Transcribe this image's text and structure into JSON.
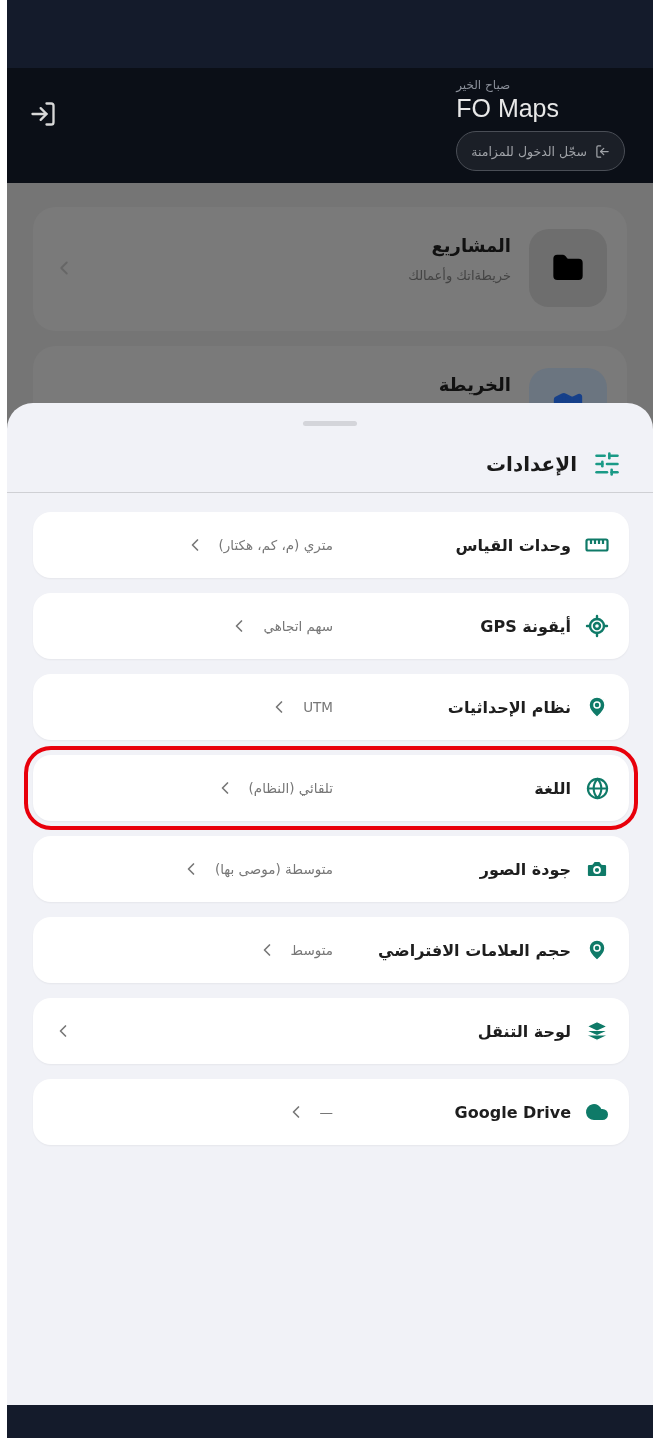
{
  "header": {
    "greeting": "صباح الخير",
    "title": "FO Maps",
    "sync_button": "سجّل الدخول للمزامنة"
  },
  "home_cards": [
    {
      "title": "المشاريع",
      "subtitle": "خريطةاتك وأعمالك"
    },
    {
      "title": "الخريطة"
    }
  ],
  "settings_sheet": {
    "title": "الإعدادات",
    "items": [
      {
        "label": "وحدات القياس",
        "value": "متري (م، كم، هكتار)",
        "highlighted": false
      },
      {
        "label": "أيقونة GPS",
        "value": "سهم اتجاهي",
        "highlighted": false
      },
      {
        "label": "نظام الإحداثيات",
        "value": "UTM",
        "highlighted": false
      },
      {
        "label": "اللغة",
        "value": "تلقائي (النظام)",
        "highlighted": true
      },
      {
        "label": "جودة الصور",
        "value": "متوسطة (موصى بها)",
        "highlighted": false
      },
      {
        "label": "حجم العلامات الافتراضي",
        "value": "متوسط",
        "highlighted": false
      },
      {
        "label": "لوحة التنقل",
        "highlighted": false
      },
      {
        "label": "Google Drive",
        "value": "—",
        "highlighted": false
      }
    ]
  }
}
